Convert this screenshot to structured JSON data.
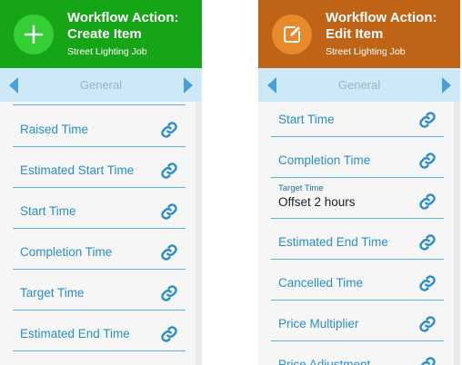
{
  "colors": {
    "create_header": "#16a516",
    "create_circle": "#35cf35",
    "edit_header": "#bf6417",
    "edit_circle": "#e8892b",
    "nav_bar": "#cde9f8",
    "accent_blue": "#2a8ecb"
  },
  "left_panel": {
    "header": {
      "icon": "plus-icon",
      "title_line1": "Workflow Action:",
      "title_line2": "Create Item",
      "subtitle": "Street Lighting Job"
    },
    "nav": {
      "label": "General",
      "prev_icon": "chevron-left-icon",
      "next_icon": "chevron-right-icon"
    },
    "fields": [
      {
        "label": "Raised Time",
        "icon": "link-icon"
      },
      {
        "label": "Estimated Start Time",
        "icon": "link-icon"
      },
      {
        "label": "Start Time",
        "icon": "link-icon"
      },
      {
        "label": "Completion Time",
        "icon": "link-icon"
      },
      {
        "label": "Target Time",
        "icon": "link-icon"
      },
      {
        "label": "Estimated End Time",
        "icon": "link-icon"
      }
    ]
  },
  "right_panel": {
    "header": {
      "icon": "edit-icon",
      "title_line1": "Workflow Action:",
      "title_line2": "Edit Item",
      "subtitle": "Street Lighting Job"
    },
    "nav": {
      "label": "General",
      "prev_icon": "chevron-left-icon",
      "next_icon": "chevron-right-icon"
    },
    "fields": [
      {
        "label": "Start Time",
        "icon": "link-icon"
      },
      {
        "label": "Completion Time",
        "icon": "link-icon"
      },
      {
        "label": "Target Time",
        "value": "Offset 2 hours",
        "icon": "link-icon"
      },
      {
        "label": "Estimated End Time",
        "icon": "link-icon"
      },
      {
        "label": "Cancelled Time",
        "icon": "link-icon"
      },
      {
        "label": "Price Multiplier",
        "icon": "link-icon"
      },
      {
        "label": "Price Adjustment",
        "icon": "link-icon"
      }
    ]
  }
}
